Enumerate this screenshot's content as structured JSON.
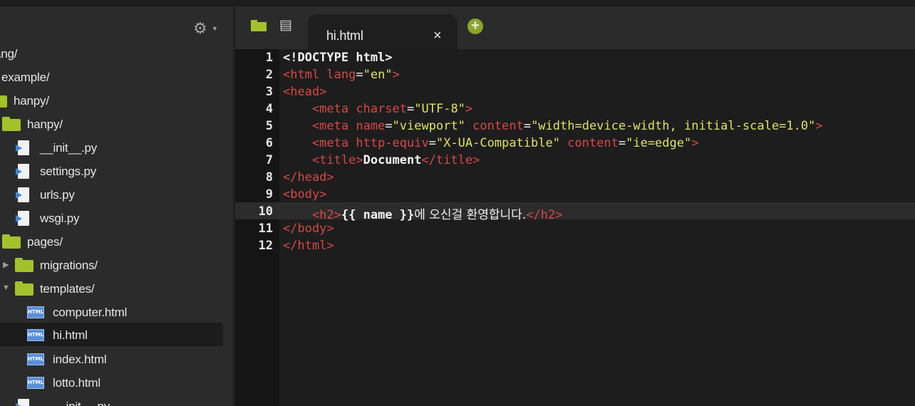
{
  "sidebar": {
    "settings_icon": "gear-icon",
    "items": [
      {
        "label": "ang/",
        "type": "folder"
      },
      {
        "label": "example/",
        "type": "folder"
      },
      {
        "label": "hanpy/",
        "type": "folder"
      },
      {
        "label": "hanpy/",
        "type": "folder"
      },
      {
        "label": "__init__.py",
        "type": "python-file"
      },
      {
        "label": "settings.py",
        "type": "python-file"
      },
      {
        "label": "urls.py",
        "type": "python-file"
      },
      {
        "label": "wsgi.py",
        "type": "python-file"
      },
      {
        "label": "pages/",
        "type": "folder"
      },
      {
        "label": "migrations/",
        "type": "folder",
        "expanded": false
      },
      {
        "label": "templates/",
        "type": "folder",
        "expanded": true
      },
      {
        "label": "computer.html",
        "type": "html-file"
      },
      {
        "label": "hi.html",
        "type": "html-file",
        "selected": true
      },
      {
        "label": "index.html",
        "type": "html-file"
      },
      {
        "label": "lotto.html",
        "type": "html-file"
      },
      {
        "label": "__init__.py",
        "type": "python-file"
      }
    ]
  },
  "tabbar": {
    "active_tab": "hi.html",
    "close_glyph": "×",
    "add_glyph": "+"
  },
  "editor": {
    "active_line": 10,
    "line_numbers": [
      "1",
      "2",
      "3",
      "4",
      "5",
      "6",
      "7",
      "8",
      "9",
      "10",
      "11",
      "12"
    ],
    "code": {
      "l1_doctype": "<!DOCTYPE html>",
      "l2_open": "<html",
      "l2_attr": " lang",
      "l2_eq": "=",
      "l2_val": "\"en\"",
      "l2_close": ">",
      "l3": "<head>",
      "l4_open": "    <meta",
      "l4_attr": " charset",
      "l4_eq": "=",
      "l4_val": "\"UTF-8\"",
      "l4_close": ">",
      "l5_open": "    <meta",
      "l5_attr1": " name",
      "l5_eq1": "=",
      "l5_val1": "\"viewport\"",
      "l5_attr2": " content",
      "l5_eq2": "=",
      "l5_val2": "\"width=device-width, initial-scale=1.0\"",
      "l5_close": ">",
      "l6_open": "    <meta",
      "l6_attr1": " http-equiv",
      "l6_eq1": "=",
      "l6_val1": "\"X-UA-Compatible\"",
      "l6_attr2": " content",
      "l6_eq2": "=",
      "l6_val2": "\"ie=edge\"",
      "l6_close": ">",
      "l7_open": "    <title>",
      "l7_text": "Document",
      "l7_close": "</title>",
      "l8": "</head>",
      "l9": "<body>",
      "l10_open": "    <h2>",
      "l10_text": "{{ name }}",
      "l10_korean": "에 오신걸 환영합니다.",
      "l10_close": "</h2>",
      "l11": "</body>",
      "l12": "</html>"
    }
  },
  "colors": {
    "tag": "#d64846",
    "string": "#dfe266",
    "folder": "#a3c22a",
    "add_button": "#8aa52a"
  }
}
